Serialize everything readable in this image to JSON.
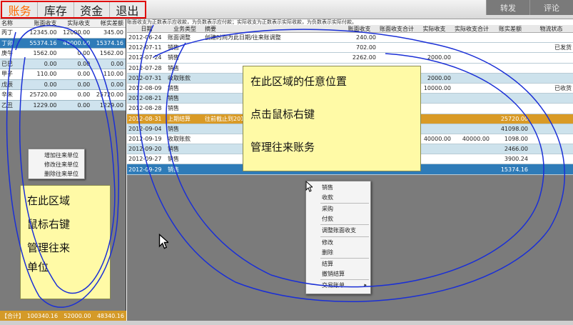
{
  "top_tabs": [
    "账务",
    "库存",
    "资金",
    "退出"
  ],
  "top_right": [
    "转发",
    "评论"
  ],
  "left": {
    "headers": [
      "名称",
      "账面收支",
      "实际收支",
      "帐实差额"
    ],
    "rows": [
      {
        "c": [
          "丙丁",
          "12345.00",
          "12000.00",
          "345.00"
        ],
        "s": "w"
      },
      {
        "c": [
          "丁卯",
          "55374.16",
          "40000.00",
          "15374.16"
        ],
        "s": "sel"
      },
      {
        "c": [
          "庚午",
          "1562.00",
          "0.00",
          "1562.00"
        ],
        "s": "w"
      },
      {
        "c": [
          "已巳",
          "0.00",
          "0.00",
          "0.00"
        ],
        "s": "b"
      },
      {
        "c": [
          "甲子",
          "110.00",
          "0.00",
          "110.00"
        ],
        "s": "w"
      },
      {
        "c": [
          "戊辰",
          "0.00",
          "0.00",
          "0.00"
        ],
        "s": "b"
      },
      {
        "c": [
          "辛未",
          "25720.00",
          "0.00",
          "25720.00"
        ],
        "s": "w"
      },
      {
        "c": [
          "乙丑",
          "1229.00",
          "0.00",
          "1229.00"
        ],
        "s": "b"
      }
    ],
    "footer": [
      "【合计】",
      "100340.16",
      "52000.00",
      "48340.16"
    ],
    "context_menu": [
      "增加往来单位",
      "修改往来单位",
      "删除往来单位"
    ],
    "note": [
      "在此区域",
      "鼠标右键",
      "管理往来",
      "单位"
    ]
  },
  "right": {
    "tip": "账面收支为正数表示应收款，为负数表示应付款；实际收支为正数表示实际收款，为负数表示实际付款。",
    "headers": [
      "日期",
      "业务类型",
      "摘要",
      "账面收支",
      "账面收支合计",
      "实际收支",
      "实际收支合计",
      "账实差额",
      "物流状态"
    ],
    "rows": [
      {
        "c": [
          "2012-06-24",
          "账面调整",
          "创建时间为此日期/往来账调整",
          "240.00",
          "",
          "",
          "",
          "",
          ""
        ],
        "s": "w"
      },
      {
        "c": [
          "2012-07-11",
          "销售",
          "",
          "702.00",
          "",
          "",
          "",
          "",
          "已发货"
        ],
        "s": "w"
      },
      {
        "c": [
          "2012-07-24",
          "销售",
          "",
          "2262.00",
          "",
          "2000.00",
          "",
          "",
          ""
        ],
        "s": "w"
      },
      {
        "c": [
          "2012-07-28",
          "销售",
          "",
          "",
          "",
          "",
          "",
          "",
          ""
        ],
        "s": "w"
      },
      {
        "c": [
          "2012-07-31",
          "收取账款",
          "",
          "",
          "",
          "2000.00",
          "",
          "",
          ""
        ],
        "s": "b"
      },
      {
        "c": [
          "2012-08-09",
          "销售",
          "",
          "",
          "",
          "10000.00",
          "",
          "",
          "已收货"
        ],
        "s": "w"
      },
      {
        "c": [
          "2012-08-21",
          "销售",
          "",
          "",
          "",
          "",
          "",
          "",
          ""
        ],
        "s": "b"
      },
      {
        "c": [
          "2012-08-28",
          "销售",
          "",
          "",
          "",
          "",
          "",
          "",
          ""
        ],
        "s": "w"
      },
      {
        "c": [
          "2012-08-31",
          "上期结算",
          "往前截止到2012",
          "",
          "",
          "",
          "",
          "25720.00",
          ""
        ],
        "s": "o"
      },
      {
        "c": [
          "2012-09-04",
          "销售",
          "",
          "",
          "",
          "",
          "",
          "41098.00",
          ""
        ],
        "s": "b"
      },
      {
        "c": [
          "2012-09-19",
          "收取账款",
          "",
          "",
          "",
          "40000.00",
          "40000.00",
          "1098.00",
          ""
        ],
        "s": "w"
      },
      {
        "c": [
          "2012-09-20",
          "销售",
          "",
          "",
          "",
          "",
          "",
          "2466.00",
          ""
        ],
        "s": "b"
      },
      {
        "c": [
          "2012-09-27",
          "销售",
          "",
          "",
          "",
          "",
          "",
          "3900.24",
          ""
        ],
        "s": "w"
      },
      {
        "c": [
          "2012-09-29",
          "销售",
          "",
          "",
          "",
          "",
          "",
          "15374.16",
          ""
        ],
        "s": "sel"
      }
    ],
    "note": [
      "在此区域的任意位置",
      "点击鼠标右键",
      "管理往来账务"
    ],
    "context_menu": [
      {
        "label": "销售",
        "sep_after": false
      },
      {
        "label": "收款",
        "sep_after": true
      },
      {
        "label": "采购",
        "sep_after": false
      },
      {
        "label": "付款",
        "sep_after": true
      },
      {
        "label": "调整账面收支",
        "sep_after": true
      },
      {
        "label": "修改",
        "sep_after": false
      },
      {
        "label": "删除",
        "sep_after": true
      },
      {
        "label": "结算",
        "sep_after": false
      },
      {
        "label": "撤销结算",
        "sep_after": true
      },
      {
        "label": "交易账单",
        "sep_after": false,
        "submenu": true
      }
    ]
  },
  "colors": {
    "tab_border": "#e00000",
    "active_tab": "#ff6a00",
    "selected_row": "#2e7bb8",
    "settle_row": "#d99a25",
    "note_bg": "#fffaa6",
    "annotation": "#1a2fd6"
  },
  "icons": [
    "mouse-cursor-icon",
    "submenu-arrow-icon"
  ]
}
